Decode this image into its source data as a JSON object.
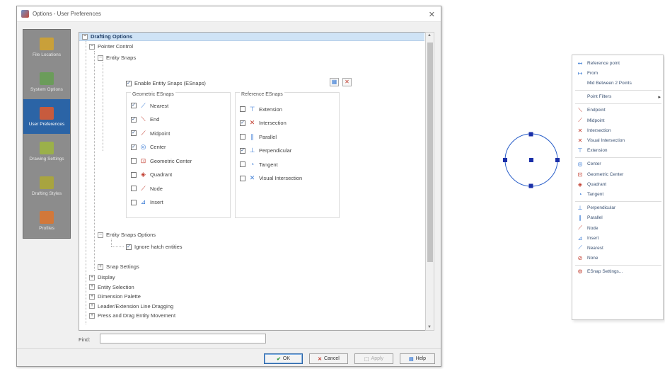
{
  "window": {
    "title": "Options - User Preferences",
    "close": "✕"
  },
  "nav": [
    {
      "label": "File Locations",
      "icon": "folder-icon",
      "color": "#c9a03a"
    },
    {
      "label": "System Options",
      "icon": "monitor-icon",
      "color": "#6b9c5a"
    },
    {
      "label": "User Preferences",
      "icon": "user-preferences-icon",
      "color": "#c75b3e"
    },
    {
      "label": "Drawing Settings",
      "icon": "drawing-settings-icon",
      "color": "#9bb04a"
    },
    {
      "label": "Drafting Styles",
      "icon": "drafting-styles-icon",
      "color": "#a8a440"
    },
    {
      "label": "Profiles",
      "icon": "profiles-icon",
      "color": "#d2783a"
    }
  ],
  "tree": {
    "root": "Drafting Options",
    "pointer_control": "Pointer Control",
    "entity_snaps": "Entity Snaps",
    "enable_snaps": "Enable Entity Snaps (ESnaps)",
    "geometric_title": "Geometric ESnaps",
    "reference_title": "Reference ESnaps",
    "geometric": [
      {
        "label": "Nearest",
        "checked": true,
        "icon": "⟋",
        "color": "#3a7bd5"
      },
      {
        "label": "End",
        "checked": true,
        "icon": "⟍",
        "color": "#c0392b"
      },
      {
        "label": "Midpoint",
        "checked": true,
        "icon": "⟋",
        "color": "#c0392b"
      },
      {
        "label": "Center",
        "checked": true,
        "icon": "◎",
        "color": "#3a7bd5"
      },
      {
        "label": "Geometric Center",
        "checked": false,
        "icon": "⊡",
        "color": "#c0392b"
      },
      {
        "label": "Quadrant",
        "checked": false,
        "icon": "◈",
        "color": "#c0392b"
      },
      {
        "label": "Node",
        "checked": false,
        "icon": "⟋",
        "color": "#c0392b"
      },
      {
        "label": "Insert",
        "checked": false,
        "icon": "⊿",
        "color": "#3a7bd5"
      }
    ],
    "reference": [
      {
        "label": "Extension",
        "checked": false,
        "icon": "⊤",
        "color": "#3a7bd5"
      },
      {
        "label": "Intersection",
        "checked": true,
        "icon": "✕",
        "color": "#c0392b"
      },
      {
        "label": "Parallel",
        "checked": false,
        "icon": "∥",
        "color": "#3a7bd5"
      },
      {
        "label": "Perpendicular",
        "checked": true,
        "icon": "⊥",
        "color": "#3a7bd5"
      },
      {
        "label": "Tangent",
        "checked": false,
        "icon": "◔",
        "color": "#3a7bd5"
      },
      {
        "label": "Visual Intersection",
        "checked": false,
        "icon": "✕",
        "color": "#3a7bd5"
      }
    ],
    "snap_options": "Entity Snaps Options",
    "ignore_hatch": "Ignore hatch entities",
    "snap_settings": "Snap Settings",
    "collapsed": [
      "Display",
      "Entity Selection",
      "Dimension Palette",
      "Leader/Extension Line Dragging",
      "Press and Drag Entity Movement"
    ]
  },
  "find": {
    "label": "Find:",
    "value": ""
  },
  "buttons": {
    "ok": "OK",
    "cancel": "Cancel",
    "apply": "Apply",
    "help": "Help"
  },
  "menu": [
    {
      "label": "Reference point",
      "icon": "↤",
      "type": "item"
    },
    {
      "label": "From",
      "icon": "↦",
      "type": "item"
    },
    {
      "label": "Mid Between 2 Points",
      "icon": "",
      "type": "item"
    },
    {
      "type": "sep"
    },
    {
      "label": "Point Filters",
      "icon": "",
      "type": "sub"
    },
    {
      "type": "sep"
    },
    {
      "label": "Endpoint",
      "icon": "⟍",
      "type": "item"
    },
    {
      "label": "Midpoint",
      "icon": "⟋",
      "type": "item"
    },
    {
      "label": "Intersection",
      "icon": "✕",
      "type": "item"
    },
    {
      "label": "Visual Intersection",
      "icon": "✕",
      "type": "item"
    },
    {
      "label": "Extension",
      "icon": "⊤",
      "type": "item"
    },
    {
      "type": "sep"
    },
    {
      "label": "Center",
      "icon": "◎",
      "type": "item"
    },
    {
      "label": "Geometric Center",
      "icon": "⊡",
      "type": "item"
    },
    {
      "label": "Quadrant",
      "icon": "◈",
      "type": "item"
    },
    {
      "label": "Tangent",
      "icon": "◔",
      "type": "item"
    },
    {
      "type": "sep"
    },
    {
      "label": "Perpendicular",
      "icon": "⊥",
      "type": "item"
    },
    {
      "label": "Parallel",
      "icon": "∥",
      "type": "item"
    },
    {
      "label": "Node",
      "icon": "⟋",
      "type": "item"
    },
    {
      "label": "Insert",
      "icon": "⊿",
      "type": "item"
    },
    {
      "label": "Nearest",
      "icon": "⟋",
      "type": "item"
    },
    {
      "label": "None",
      "icon": "⊘",
      "type": "item"
    },
    {
      "type": "sep"
    },
    {
      "label": "ESnap Settings...",
      "icon": "⚙",
      "type": "item"
    }
  ],
  "colors": {
    "accent": "#2b64a6",
    "snap_marker": "#1a2fa8"
  }
}
